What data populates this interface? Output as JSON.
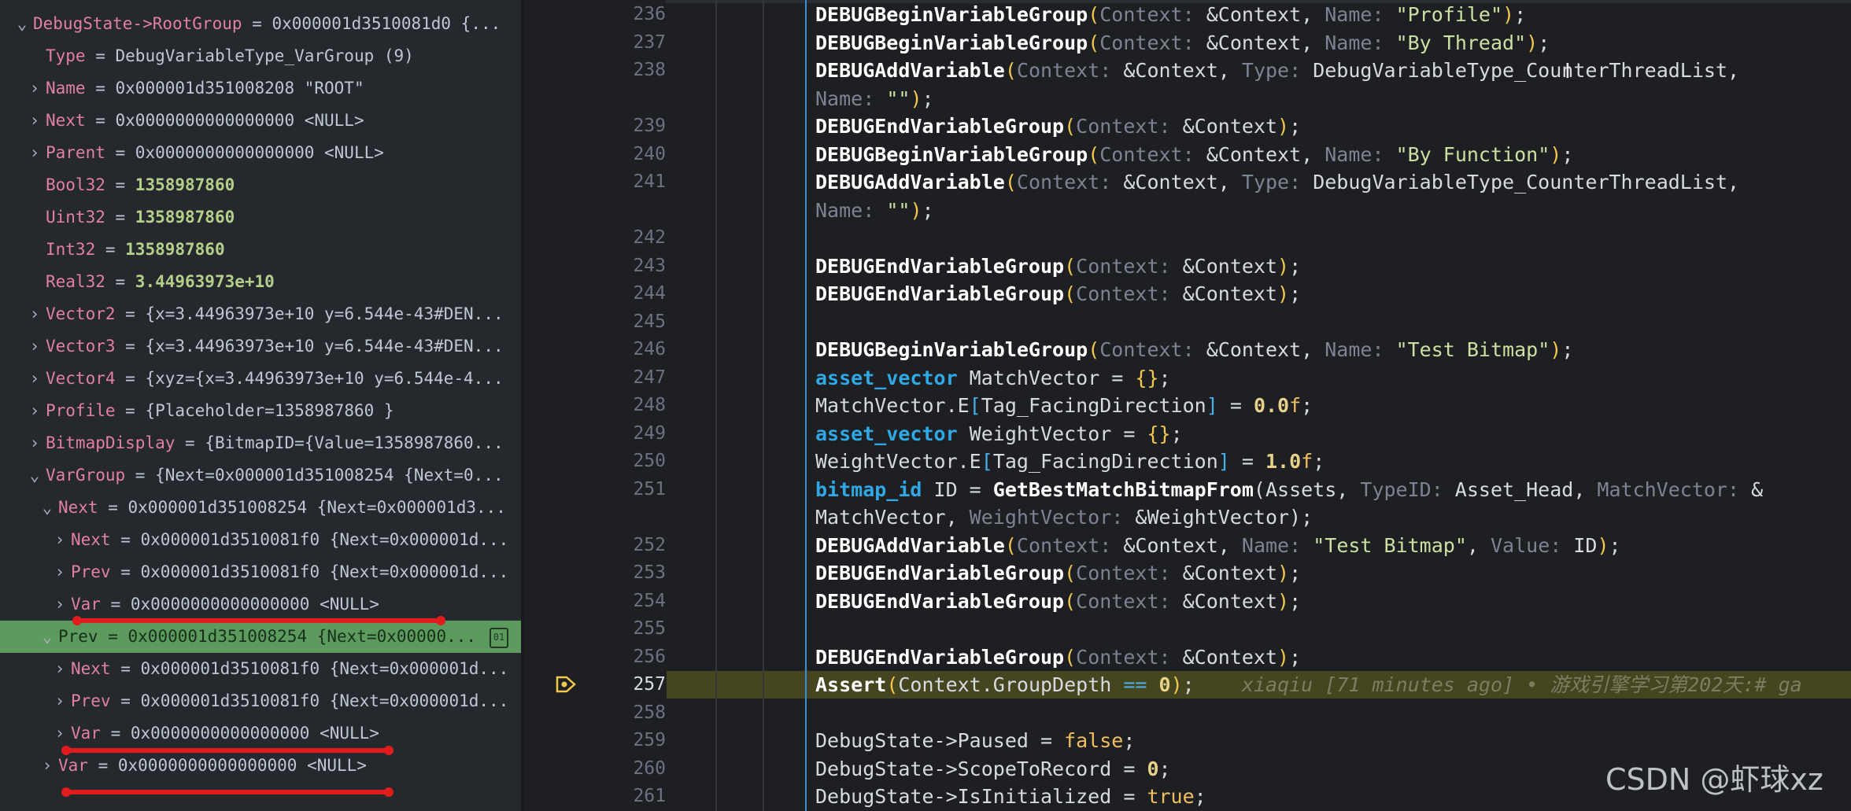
{
  "variables": [
    {
      "indent": 0,
      "chevron": "down",
      "name": "DebugState->RootGroup",
      "value": "0x000001d3510081d0 {..."
    },
    {
      "indent": 1,
      "chevron": "none",
      "name": "Type",
      "value": "DebugVariableType_VarGroup (9)"
    },
    {
      "indent": 1,
      "chevron": "right",
      "name": "Name",
      "value": "0x000001d351008208 \"ROOT\""
    },
    {
      "indent": 1,
      "chevron": "right",
      "name": "Next",
      "value": "0x0000000000000000 <NULL>"
    },
    {
      "indent": 1,
      "chevron": "right",
      "name": "Parent",
      "value": "0x0000000000000000 <NULL>"
    },
    {
      "indent": 1,
      "chevron": "none",
      "name": "Bool32",
      "value": "1358987860",
      "numeric": true
    },
    {
      "indent": 1,
      "chevron": "none",
      "name": "Uint32",
      "value": "1358987860",
      "numeric": true
    },
    {
      "indent": 1,
      "chevron": "none",
      "name": "Int32",
      "value": "1358987860",
      "numeric": true
    },
    {
      "indent": 1,
      "chevron": "none",
      "name": "Real32",
      "value": "3.44963973e+10",
      "numeric": true
    },
    {
      "indent": 1,
      "chevron": "right",
      "name": "Vector2",
      "value": "{x=3.44963973e+10 y=6.544e-43#DEN..."
    },
    {
      "indent": 1,
      "chevron": "right",
      "name": "Vector3",
      "value": "{x=3.44963973e+10 y=6.544e-43#DEN..."
    },
    {
      "indent": 1,
      "chevron": "right",
      "name": "Vector4",
      "value": "{xyz={x=3.44963973e+10 y=6.544e-4..."
    },
    {
      "indent": 1,
      "chevron": "right",
      "name": "Profile",
      "value": "{Placeholder=1358987860 }"
    },
    {
      "indent": 1,
      "chevron": "right",
      "name": "BitmapDisplay",
      "value": "{BitmapID={Value=1358987860..."
    },
    {
      "indent": 1,
      "chevron": "down",
      "name": "VarGroup",
      "value": "{Next=0x000001d351008254 {Next=0..."
    },
    {
      "indent": 2,
      "chevron": "down",
      "name": "Next",
      "value": "0x000001d351008254 {Next=0x000001d3..."
    },
    {
      "indent": 3,
      "chevron": "right",
      "name": "Next",
      "value": "0x000001d3510081f0 {Next=0x000001d..."
    },
    {
      "indent": 3,
      "chevron": "right",
      "name": "Prev",
      "value": "0x000001d3510081f0 {Next=0x000001d..."
    },
    {
      "indent": 3,
      "chevron": "right",
      "name": "Var",
      "value": "0x0000000000000000 <NULL>"
    },
    {
      "indent": 2,
      "chevron": "down",
      "name": "Prev",
      "value": "0x000001d351008254 {Next=0x00000...",
      "selected": true
    },
    {
      "indent": 3,
      "chevron": "right",
      "name": "Next",
      "value": "0x000001d3510081f0 {Next=0x000001d..."
    },
    {
      "indent": 3,
      "chevron": "right",
      "name": "Prev",
      "value": "0x000001d3510081f0 {Next=0x000001d..."
    },
    {
      "indent": 3,
      "chevron": "right",
      "name": "Var",
      "value": "0x0000000000000000 <NULL>"
    },
    {
      "indent": 2,
      "chevron": "right",
      "name": "Var",
      "value": "0x0000000000000000 <NULL>"
    }
  ],
  "selected_row_action_icon": "binary-view-icon",
  "code": {
    "current_line": "257",
    "lines": [
      {
        "num": "236",
        "html": "<span class='fn'>DEBUGBeginVariableGroup</span><span class='paren'>(</span><span class='hint'>Context:</span> &amp;Context, <span class='hint'>Name:</span> <span class='str'>\"Profile\"</span><span class='paren'>)</span>;"
      },
      {
        "num": "237",
        "html": "<span class='fn'>DEBUGBeginVariableGroup</span><span class='paren'>(</span><span class='hint'>Context:</span> &amp;Context, <span class='hint'>Name:</span> <span class='str'>\"By Thread\"</span><span class='paren'>)</span>;"
      },
      {
        "num": "238",
        "html": "<span class='fn'>DEBUGAddVariable</span><span class='paren'>(</span><span class='hint'>Context:</span> &amp;Context, <span class='hint'>Type:</span> DebugVariableType_CounterThreadList,"
      },
      {
        "num": "",
        "html": "<span class='hint'>Name:</span> <span class='str'>\"\"</span><span class='paren'>)</span>;"
      },
      {
        "num": "239",
        "html": "<span class='fn'>DEBUGEndVariableGroup</span><span class='paren'>(</span><span class='hint'>Context:</span> &amp;Context<span class='paren'>)</span>;"
      },
      {
        "num": "240",
        "html": "<span class='fn'>DEBUGBeginVariableGroup</span><span class='paren'>(</span><span class='hint'>Context:</span> &amp;Context, <span class='hint'>Name:</span> <span class='str'>\"By Function\"</span><span class='paren'>)</span>;"
      },
      {
        "num": "241",
        "html": "<span class='fn'>DEBUGAddVariable</span><span class='paren'>(</span><span class='hint'>Context:</span> &amp;Context, <span class='hint'>Type:</span> DebugVariableType_CounterThreadList,"
      },
      {
        "num": "",
        "html": "<span class='hint'>Name:</span> <span class='str'>\"\"</span><span class='paren'>)</span>;"
      },
      {
        "num": "242",
        "html": ""
      },
      {
        "num": "243",
        "html": "<span class='fn'>DEBUGEndVariableGroup</span><span class='paren'>(</span><span class='hint'>Context:</span> &amp;Context<span class='paren'>)</span>;"
      },
      {
        "num": "244",
        "html": "<span class='fn'>DEBUGEndVariableGroup</span><span class='paren'>(</span><span class='hint'>Context:</span> &amp;Context<span class='paren'>)</span>;"
      },
      {
        "num": "245",
        "html": ""
      },
      {
        "num": "246",
        "html": "<span class='fn'>DEBUGBeginVariableGroup</span><span class='paren'>(</span><span class='hint'>Context:</span> &amp;Context, <span class='hint'>Name:</span> <span class='str'>\"Test Bitmap\"</span><span class='paren'>)</span>;"
      },
      {
        "num": "247",
        "html": "<span class='ty'>asset_vector</span> MatchVector = <span class='paren'>{}</span>;"
      },
      {
        "num": "248",
        "html": "MatchVector.E<span class='op'>[</span>Tag_FacingDirection<span class='op'>]</span> = <span class='num'>0.0</span><span class='kw'>f</span>;"
      },
      {
        "num": "249",
        "html": "<span class='ty'>asset_vector</span> WeightVector = <span class='paren'>{}</span>;"
      },
      {
        "num": "250",
        "html": "WeightVector.E<span class='op'>[</span>Tag_FacingDirection<span class='op'>]</span> = <span class='num'>1.0</span><span class='kw'>f</span>;"
      },
      {
        "num": "251",
        "html": "<span class='ty'>bitmap_id</span> ID = <span class='fn'>GetBestMatchBitmapFrom</span>(Assets, <span class='hint'>TypeID:</span> Asset_Head, <span class='hint'>MatchVector:</span> &amp;"
      },
      {
        "num": "",
        "html": "MatchVector, <span class='hint'>WeightVector:</span> &amp;WeightVector);"
      },
      {
        "num": "252",
        "html": "<span class='fn'>DEBUGAddVariable</span><span class='paren'>(</span><span class='hint'>Context:</span> &amp;Context, <span class='hint'>Name:</span> <span class='str'>\"Test Bitmap\"</span>, <span class='hint'>Value:</span> ID<span class='paren'>)</span>;"
      },
      {
        "num": "253",
        "html": "<span class='fn'>DEBUGEndVariableGroup</span><span class='paren'>(</span><span class='hint'>Context:</span> &amp;Context<span class='paren'>)</span>;"
      },
      {
        "num": "254",
        "html": "<span class='fn'>DEBUGEndVariableGroup</span><span class='paren'>(</span><span class='hint'>Context:</span> &amp;Context<span class='paren'>)</span>;"
      },
      {
        "num": "255",
        "html": ""
      },
      {
        "num": "256",
        "html": "<span class='fn'>DEBUGEndVariableGroup</span><span class='paren'>(</span><span class='hint'>Context:</span> &amp;Context<span class='paren'>)</span>;"
      },
      {
        "num": "257",
        "html": "<span class='fn'>Assert</span><span class='paren'>(</span>Context.GroupDepth <span class='op'>==</span> <span class='num'>0</span><span class='paren'>)</span>;    <span class='blame'>xiaqiu [71 minutes ago] • 游戏引擎学习第202天:# ga</span>"
      },
      {
        "num": "258",
        "html": ""
      },
      {
        "num": "259",
        "html": "DebugState->Paused = <span class='kw'>false</span>;"
      },
      {
        "num": "260",
        "html": "DebugState->ScopeToRecord = <span class='num'>0</span>;"
      },
      {
        "num": "261",
        "html": "DebugState->IsInitialized = <span class='kw'>true</span>;"
      }
    ]
  },
  "watermark": "CSDN @虾球xz"
}
